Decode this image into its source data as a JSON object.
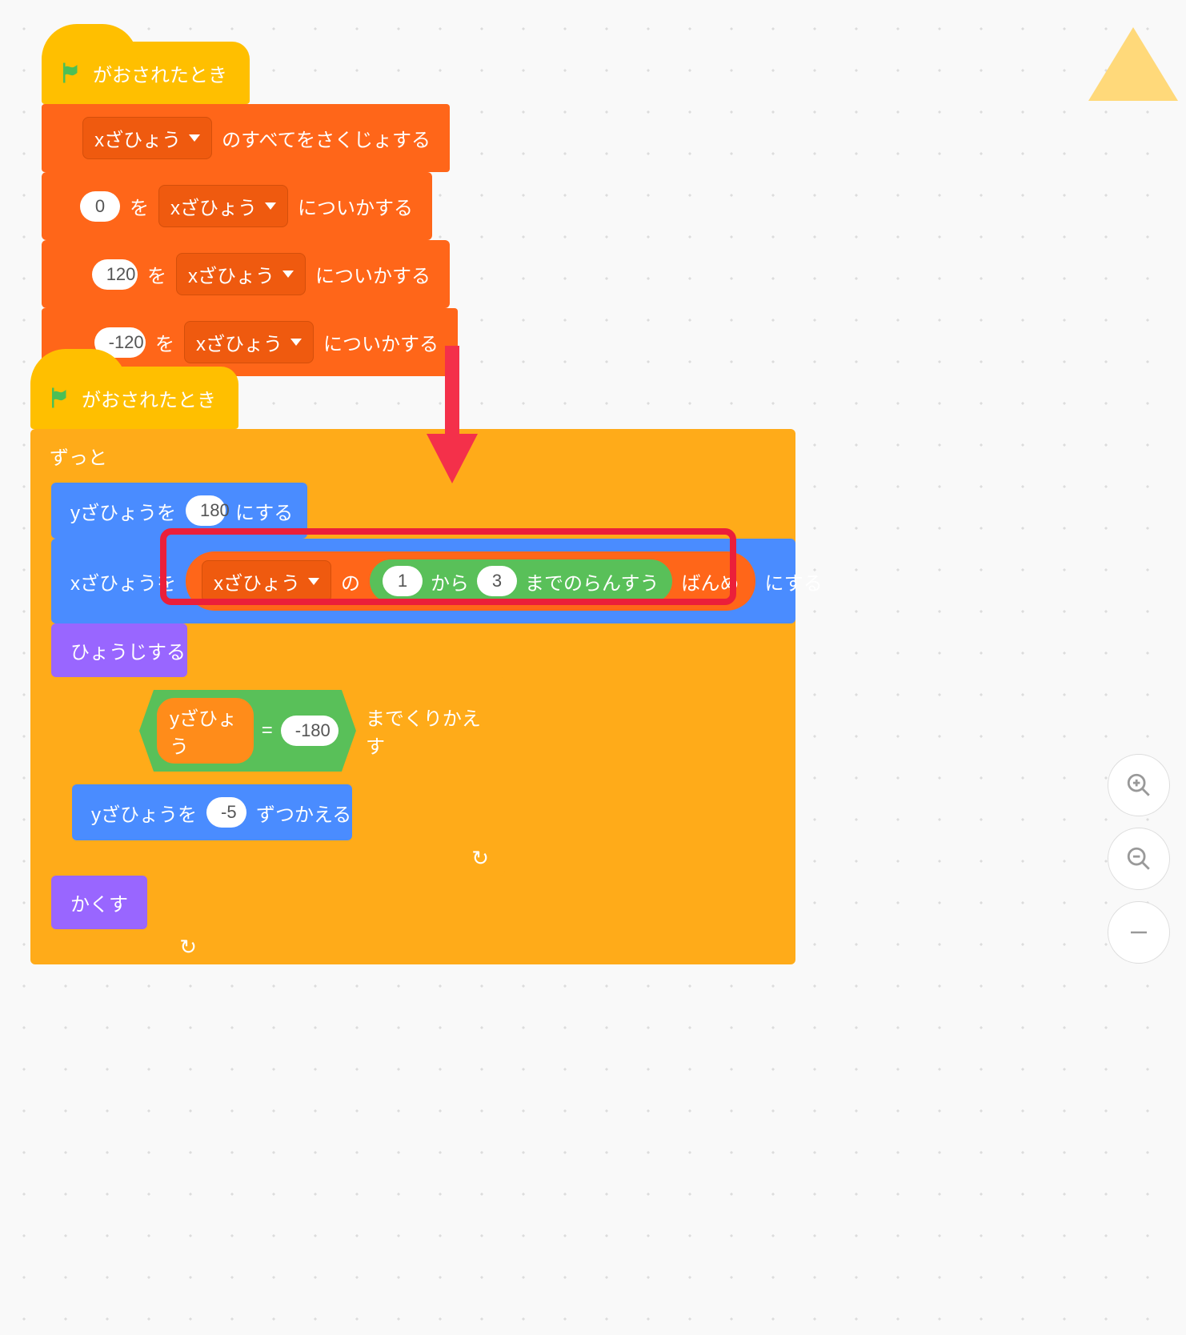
{
  "hat_label": "がおされたとき",
  "list_var": "xざひょう",
  "delete_all_suffix": "のすべてをさくじょする",
  "add_word_to": "を",
  "add_suffix": "についかする",
  "add_values": {
    "v0": "0",
    "v1": "120",
    "v2": "-120"
  },
  "forever_label": "ずっと",
  "set_y_prefix": "yざひょうを",
  "set_y_value": "180",
  "set_suffix": "にする",
  "set_x_prefix": "xざひょうを",
  "item_of_word": "の",
  "item_suffix": "ばんめ",
  "random_from": "から",
  "random_suffix": "までのらんすう",
  "random_a": "1",
  "random_b": "3",
  "show_label": "ひょうじする",
  "repeat_until_suffix": "までくりかえす",
  "y_var_label": "yざひょう",
  "equals_sign": "=",
  "equals_value": "-180",
  "change_y_prefix": "yざひょうを",
  "change_y_value": "-5",
  "change_y_suffix": "ずつかえる",
  "hide_label": "かくす",
  "loop_arrow": "↻"
}
